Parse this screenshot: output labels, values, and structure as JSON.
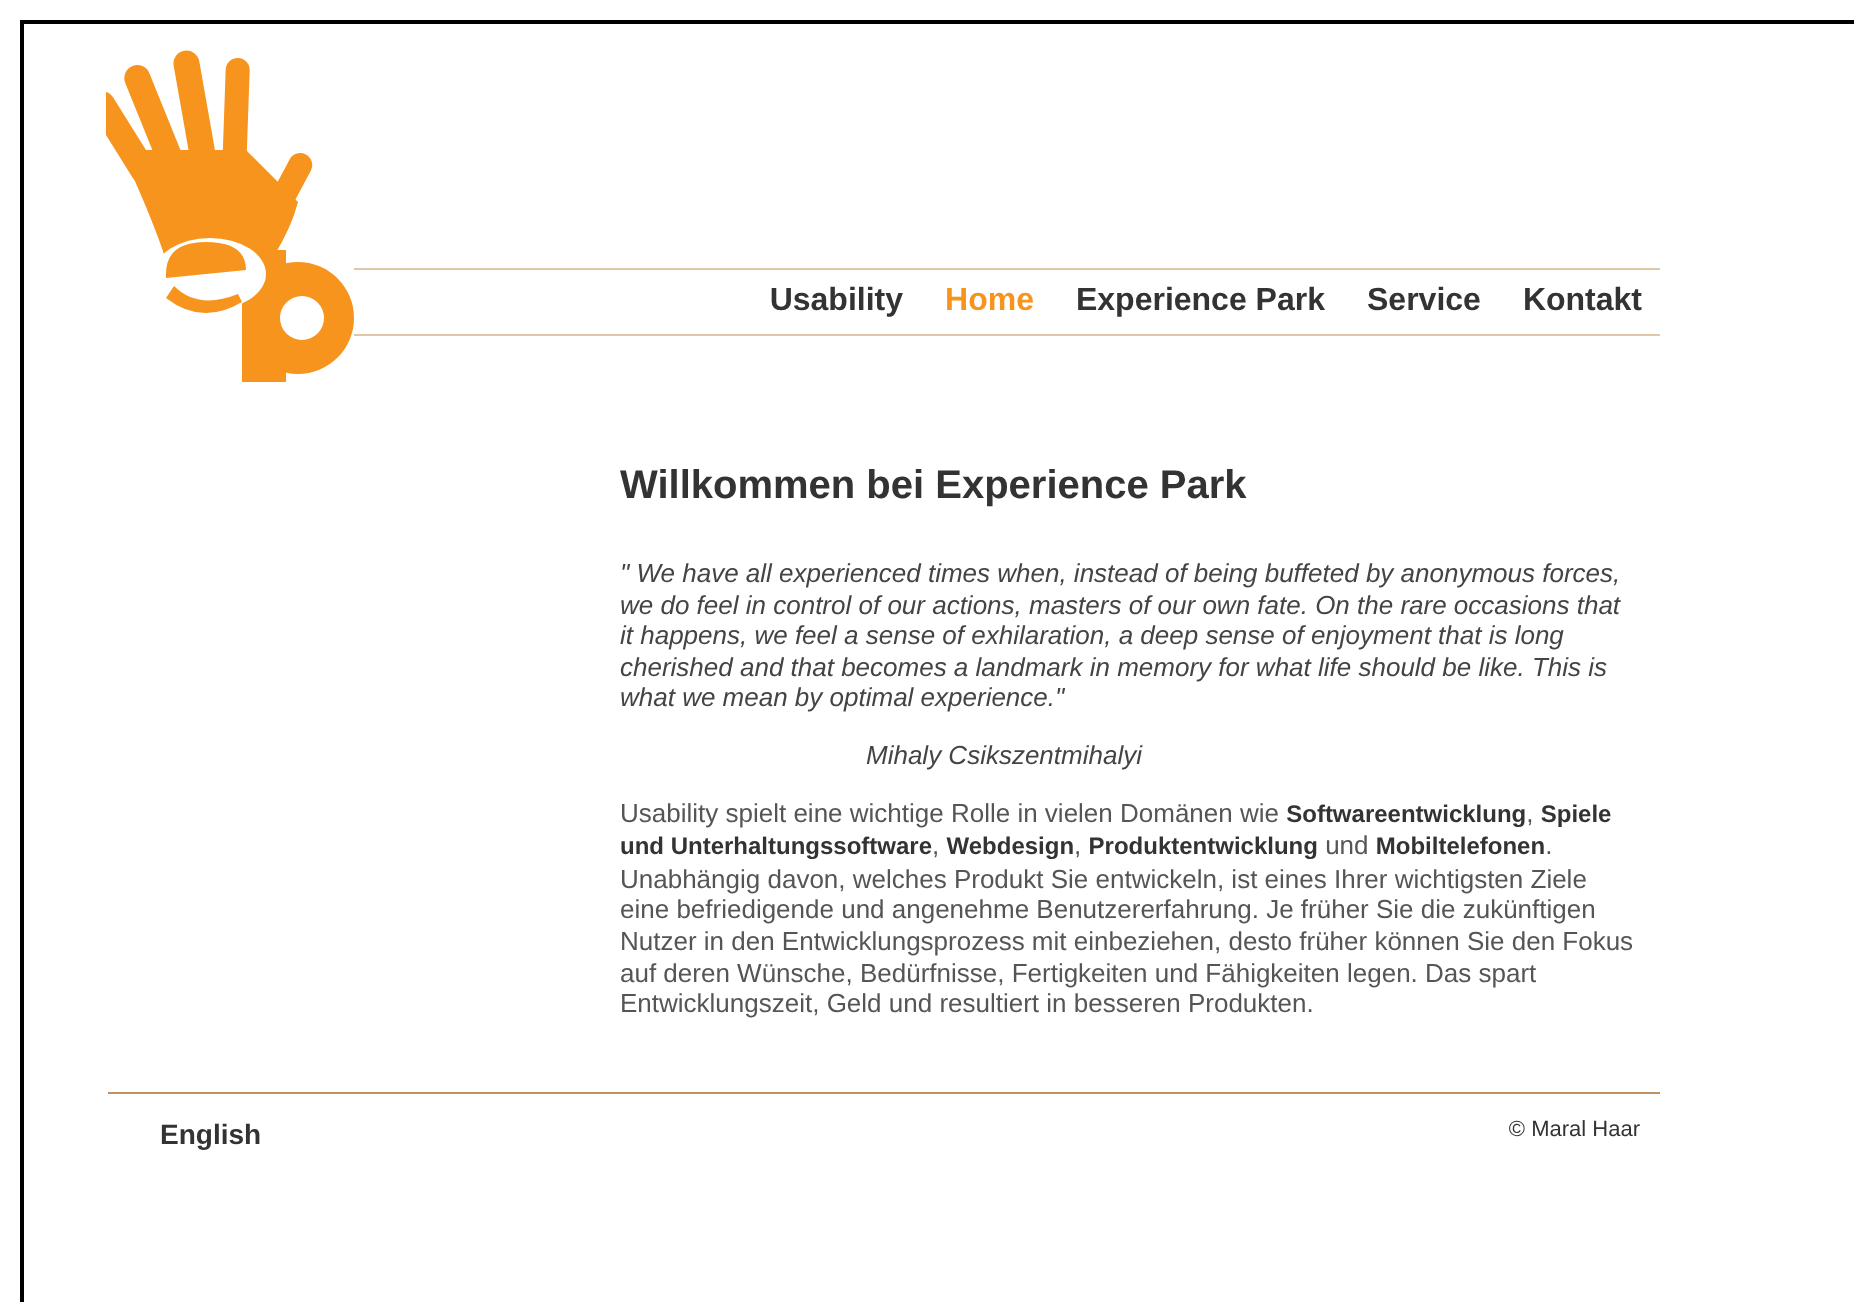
{
  "nav": [
    {
      "label": "Usability",
      "selected": false
    },
    {
      "label": "Home",
      "selected": true
    },
    {
      "label": "Experience Park",
      "selected": false
    },
    {
      "label": "Service",
      "selected": false
    },
    {
      "label": "Kontakt",
      "selected": false
    }
  ],
  "heading": "Willkommen bei Experience Park",
  "quote": "\" We have all experienced times when, instead of being buffeted by anonymous forces, we do feel in control of our actions, masters of our own fate. On the rare occasions that it happens, we feel a sense of exhilaration, a deep sense of enjoyment that is long cherished and that becomes a landmark in memory for what life should be like. This is what we mean by optimal experience.\"",
  "quote_author": "Mihaly Csikszentmihalyi",
  "body": "Usability spielt eine wichtige Rolle in vielen Domänen wie **Softwareentwicklung**, **Spiele und Unterhaltungssoftware**, **Webdesign**, **Produktentwicklung** und **Mobiltelefonen**. Unabhängig davon, welches Produkt Sie entwickeln, ist eines Ihrer wichtigsten Ziele eine befriedigende und angenehme Benutzererfahrung. Je früher Sie die zukünftigen Nutzer in den Entwicklungsprozess mit einbeziehen, desto früher können Sie den Fokus auf deren Wünsche, Bedürfnisse, Fertigkeiten und Fähigkeiten legen. Das spart Entwicklungszeit, Geld und resultiert in besseren Produkten.",
  "footer": {
    "language_link": "English",
    "copyright": "© Maral Haar"
  }
}
